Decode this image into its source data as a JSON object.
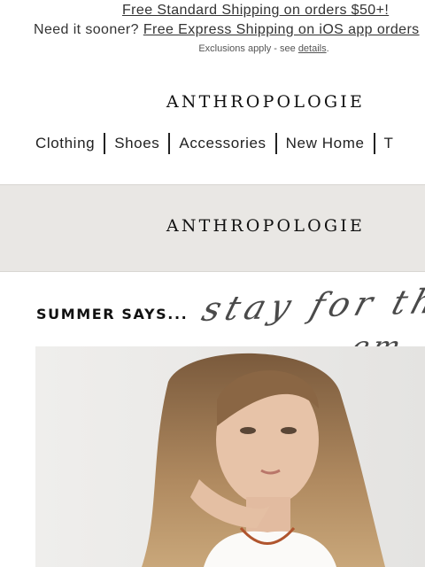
{
  "shipping": {
    "line1_link": "Free Standard Shipping on orders $50+!",
    "line2_prefix": "Need it sooner? ",
    "line2_link": "Free Express Shipping on iOS app orders",
    "exclusions_prefix": "Exclusions apply - see ",
    "exclusions_link": "details",
    "exclusions_suffix": "."
  },
  "brand": {
    "name": "ANTHROPOLOGIE"
  },
  "nav": {
    "items": [
      "Clothing",
      "Shoes",
      "Accessories",
      "New Home",
      "T"
    ]
  },
  "hero": {
    "brand": "ANTHROPOLOGIE",
    "band_color": "#e9e7e4"
  },
  "promo": {
    "headline": "SUMMER SAYS...",
    "script_line1": "stay for the",
    "script_line2": "em"
  },
  "image": {
    "description_icon": "model-photo"
  }
}
